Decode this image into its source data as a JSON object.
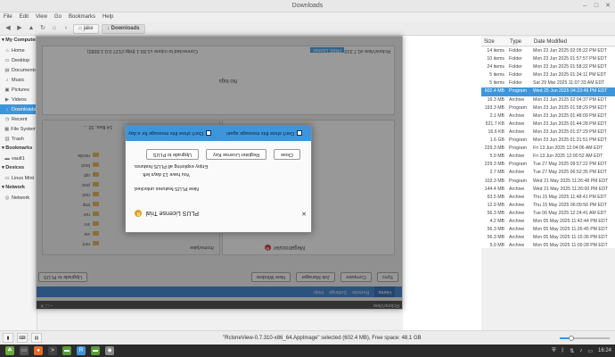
{
  "window": {
    "title": "Downloads"
  },
  "menu": [
    "File",
    "Edit",
    "View",
    "Go",
    "Bookmarks",
    "Help"
  ],
  "breadcrumbs": [
    "jake",
    "Downloads"
  ],
  "sidebar": {
    "sections": [
      {
        "title": "My Computer",
        "items": [
          {
            "label": "Home",
            "icon": "home-icon",
            "glyph": "⌂"
          },
          {
            "label": "Desktop",
            "icon": "desktop-icon",
            "glyph": "▭"
          },
          {
            "label": "Documents",
            "icon": "documents-icon",
            "glyph": "▤"
          },
          {
            "label": "Music",
            "icon": "music-icon",
            "glyph": "♪"
          },
          {
            "label": "Pictures",
            "icon": "pictures-icon",
            "glyph": "▣"
          },
          {
            "label": "Videos",
            "icon": "videos-icon",
            "glyph": "▶"
          },
          {
            "label": "Downloads",
            "icon": "downloads-icon",
            "glyph": "↓",
            "selected": true
          },
          {
            "label": "Recent",
            "icon": "recent-icon",
            "glyph": "◷"
          },
          {
            "label": "File System",
            "icon": "filesystem-icon",
            "glyph": "▦"
          },
          {
            "label": "Trash",
            "icon": "trash-icon",
            "glyph": "🗑"
          }
        ]
      },
      {
        "title": "Bookmarks",
        "items": [
          {
            "label": "vault1",
            "icon": "folder-icon",
            "glyph": "▬"
          }
        ]
      },
      {
        "title": "Devices",
        "items": [
          {
            "label": "Linux Mint",
            "icon": "drive-icon",
            "glyph": "▭"
          }
        ]
      },
      {
        "title": "Network",
        "items": [
          {
            "label": "Network",
            "icon": "network-icon",
            "glyph": "◎"
          }
        ]
      }
    ]
  },
  "columns": {
    "size": "Size",
    "type": "Type",
    "date": "Date Modified"
  },
  "files": [
    {
      "size": "14 items",
      "type": "Folder",
      "date": "Mon 23 Jun 2025 02:05:22 PM EDT"
    },
    {
      "size": "10 items",
      "type": "Folder",
      "date": "Mon 23 Jun 2025 01:57:57 PM EDT"
    },
    {
      "size": "24 items",
      "type": "Folder",
      "date": "Mon 23 Jun 2025 01:58:22 PM EDT"
    },
    {
      "size": "5 items",
      "type": "Folder",
      "date": "Mon 23 Jun 2025 01:34:11 PM EDT"
    },
    {
      "size": "5 items",
      "type": "Folder",
      "date": "Sat 29 Mar 2025 11:07:33 AM EDT"
    },
    {
      "size": "602.4 MB",
      "type": "Program",
      "date": "Wed 25 Jun 2025 04:23:49 PM EDT",
      "selected": true
    },
    {
      "size": "16.3 MB",
      "type": "Archive",
      "date": "Mon 23 Jun 2025 02:04:37 PM EDT"
    },
    {
      "size": "193.3 MB",
      "type": "Program",
      "date": "Mon 23 Jun 2025 01:58:29 PM EDT"
    },
    {
      "size": "2.1 MB",
      "type": "Archive",
      "date": "Mon 23 Jun 2025 01:48:09 PM EDT"
    },
    {
      "size": "521.7 KB",
      "type": "Archive",
      "date": "Mon 23 Jun 2025 01:44:28 PM EDT"
    },
    {
      "size": "16.6 KB",
      "type": "Archive",
      "date": "Mon 23 Jun 2025 01:37:29 PM EDT"
    },
    {
      "size": "1.6 GB",
      "type": "Program",
      "date": "Mon 23 Jun 2025 01:31:51 PM EDT"
    },
    {
      "size": "229.3 MB",
      "type": "Program",
      "date": "Fri 13 Jun 2025 12:04:06 AM EDT"
    },
    {
      "size": "5.9 MB",
      "type": "Archive",
      "date": "Fri 13 Jun 2025 12:00:52 AM EDT"
    },
    {
      "size": "229.3 MB",
      "type": "Program",
      "date": "Tue 27 May 2025 09:57:22 PM EDT"
    },
    {
      "size": "2.7 MB",
      "type": "Archive",
      "date": "Tue 27 May 2025 06:52:35 PM EDT"
    },
    {
      "size": "102.3 MB",
      "type": "Program",
      "date": "Wed 21 May 2025 11:26:48 PM EDT"
    },
    {
      "size": "144.4 MB",
      "type": "Archive",
      "date": "Wed 21 May 2025 11:26:00 PM EDT"
    },
    {
      "size": "63.5 MB",
      "type": "Archive",
      "date": "Thu 15 May 2025 11:48:41 PM EDT"
    },
    {
      "size": "12.9 MB",
      "type": "Archive",
      "date": "Thu 15 May 2025 06:09:56 PM EDT"
    },
    {
      "size": "56.3 MB",
      "type": "Archive",
      "date": "Tue 06 May 2025 12:24:41 AM EDT"
    },
    {
      "size": "4.2 MB",
      "type": "Archive",
      "date": "Mon 05 May 2025 11:42:44 PM EDT"
    },
    {
      "size": "56.3 MB",
      "type": "Archive",
      "date": "Mon 05 May 2025 11:26:45 PM EDT"
    },
    {
      "size": "56.3 MB",
      "type": "Archive",
      "date": "Mon 05 May 2025 11:15:36 PM EDT"
    },
    {
      "size": "5.9 MB",
      "type": "Archive",
      "date": "Mon 05 May 2025 11:09:28 PM EDT"
    }
  ],
  "app": {
    "title": "RcloneView",
    "connection": "Connected to rclone v1.69.1 (http://127.0.0.1:5582)",
    "version": "RcloneView v0.7.310",
    "free_license": "FREE License",
    "log_label": "No logs",
    "tabs": [
      "Home",
      "Remote",
      "Settings",
      "Help"
    ],
    "buttons": [
      "Sync",
      "Compare",
      "Job Manager",
      "New Window",
      "Upgrade to PLUS"
    ],
    "remote_name": "Megatrooster",
    "items_label": "14 files, 32 ...",
    "path": "/home/jake",
    "folders": [
      "mnt",
      "var",
      "srv",
      "run",
      "tmp",
      "root",
      "proc",
      "opt",
      "boot",
      "media"
    ]
  },
  "dialog": {
    "title": "PLUS License Trial",
    "line1": "New PLUS features unlocked.",
    "line2": "You have 13 days left.",
    "line3": "Enjoy exploring all PLUS features.",
    "btn_upgrade": "Upgrade to PLUS",
    "btn_register": "Register License Key",
    "btn_close": "Close",
    "check1": "Don't show this message for a day",
    "check2": "Don't show this message again"
  },
  "status": {
    "text": "\"RcloneView-0.7.310-x86_64.AppImage\" selected (602.4 MB), Free space: 48.1 GB",
    "zoom": 0.2
  },
  "taskbar": {
    "clock": "16:24"
  }
}
